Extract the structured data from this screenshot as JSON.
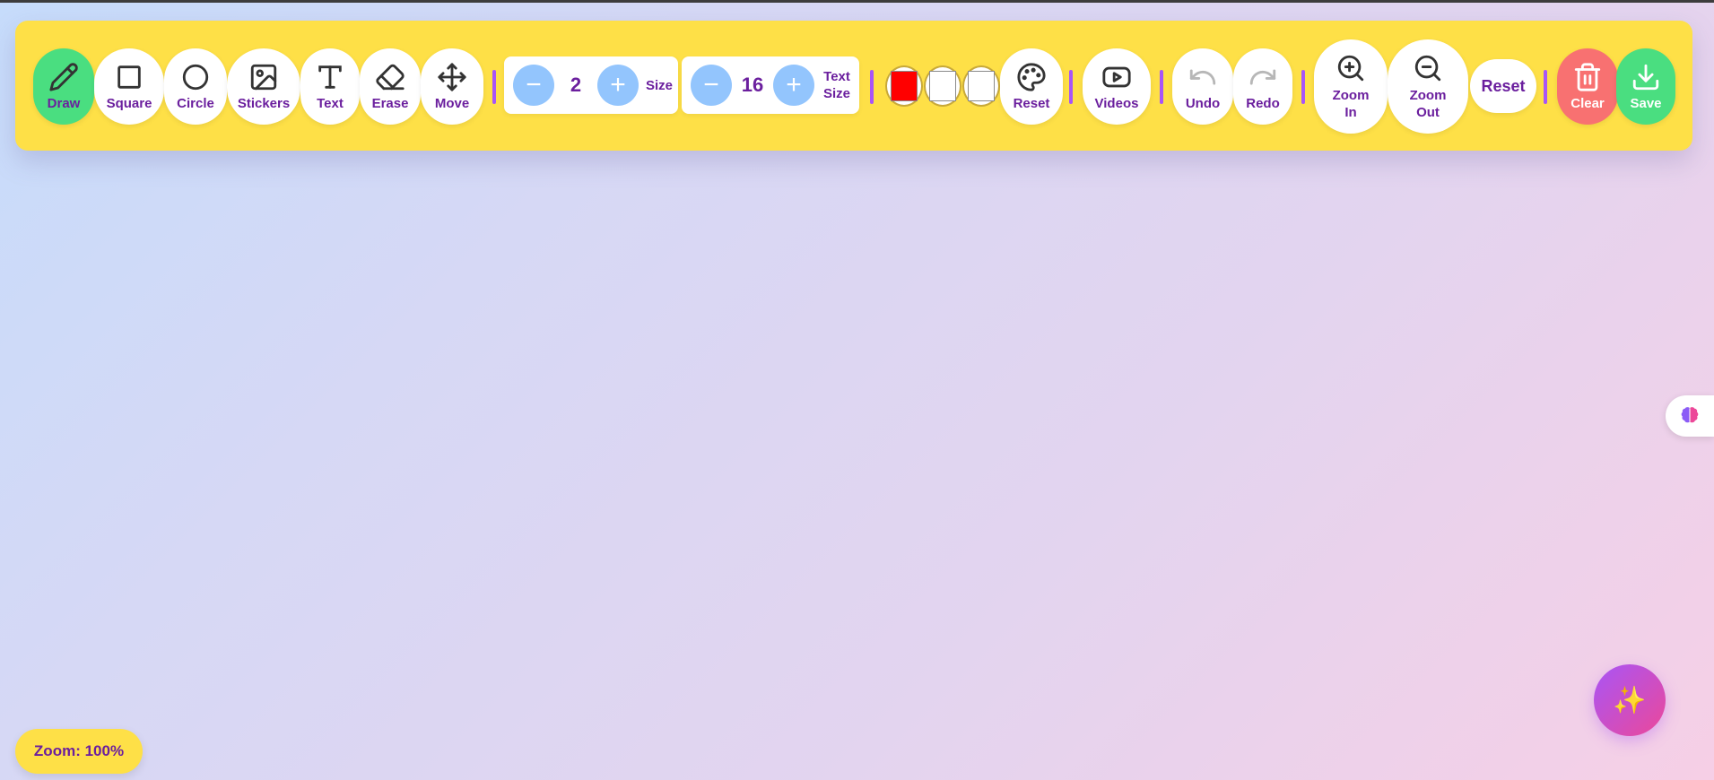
{
  "toolbar": {
    "tools": {
      "draw": "Draw",
      "square": "Square",
      "circle": "Circle",
      "stickers": "Stickers",
      "text": "Text",
      "erase": "Erase",
      "move": "Move"
    },
    "brush_size": {
      "value": "2",
      "label": "Size"
    },
    "text_size": {
      "value": "16",
      "label_line1": "Text",
      "label_line2": "Size"
    },
    "colors": {
      "swatches": [
        "#ff0000",
        "#ffffff",
        "#ffffff"
      ],
      "reset_label": "Reset"
    },
    "videos_label": "Videos",
    "undo_label": "Undo",
    "redo_label": "Redo",
    "zoom_in": {
      "line1": "Zoom",
      "line2": "In"
    },
    "zoom_out": {
      "line1": "Zoom",
      "line2": "Out"
    },
    "zoom_reset_label": "Reset",
    "clear_label": "Clear",
    "save_label": "Save",
    "accent_yellow": "#fee047",
    "accent_purple": "#6b1f9e"
  },
  "status": {
    "zoom": "Zoom: 100%"
  },
  "side_tab": {
    "icon": "brain-icon"
  },
  "fab": {
    "icon": "sparkles-icon",
    "glyph": "✨"
  }
}
